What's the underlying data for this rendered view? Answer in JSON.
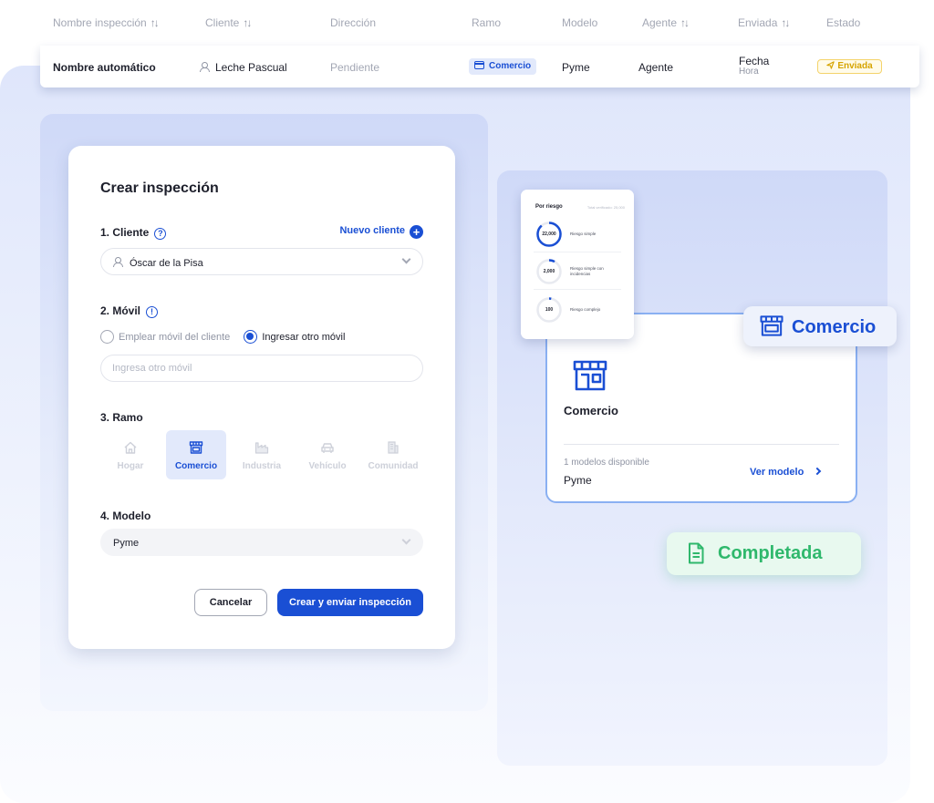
{
  "table": {
    "headers": {
      "nombre": "Nombre inspección",
      "cliente": "Cliente",
      "direccion": "Dirección",
      "ramo": "Ramo",
      "modelo": "Modelo",
      "agente": "Agente",
      "enviada": "Enviada",
      "estado": "Estado"
    },
    "sort_glyph": "↑↓",
    "row": {
      "nombre": "Nombre automático",
      "cliente": "Leche Pascual",
      "direccion": "Pendiente",
      "ramo": "Comercio",
      "modelo": "Pyme",
      "agente": "Agente",
      "fecha": "Fecha",
      "hora": "Hora",
      "estado": "Enviada"
    }
  },
  "form": {
    "title": "Crear inspección",
    "cliente": {
      "label": "1. Cliente",
      "help": "?",
      "nuevo_cliente": "Nuevo cliente",
      "plus": "+",
      "value": "Óscar de la Pisa"
    },
    "movil": {
      "label": "2. Móvil",
      "help": "!",
      "option_cliente": "Emplear móvil del cliente",
      "option_otro": "Ingresar otro móvil",
      "selected": "otro",
      "placeholder": "Ingresa otro móvil"
    },
    "ramo": {
      "label": "3. Ramo",
      "options": [
        "Hogar",
        "Comercio",
        "Industria",
        "Vehículo",
        "Comunidad"
      ],
      "selected": "Comercio"
    },
    "modelo": {
      "label": "4. Modelo",
      "value": "Pyme"
    },
    "cancel_label": "Cancelar",
    "submit_label": "Crear y enviar inspección"
  },
  "model_card": {
    "title": "Comercio",
    "count": "1 modelos disponible",
    "model": "Pyme",
    "link": "Ver modelo"
  },
  "risk_card": {
    "title": "Por riesgo",
    "total": "Total verificado: 25,000",
    "items": [
      {
        "value": "22,000",
        "label": "Riesgo simple",
        "fraction": 0.88
      },
      {
        "value": "2,000",
        "label": "Riesgo simple con incidencias",
        "fraction": 0.08
      },
      {
        "value": "100",
        "label": "Riesgo complejo",
        "fraction": 0.004
      }
    ]
  },
  "badges": {
    "comercio": "Comercio",
    "completada": "Completada"
  },
  "colors": {
    "primary": "#1a4fd4",
    "success": "#2fb86c",
    "warning": "#d6a400"
  }
}
